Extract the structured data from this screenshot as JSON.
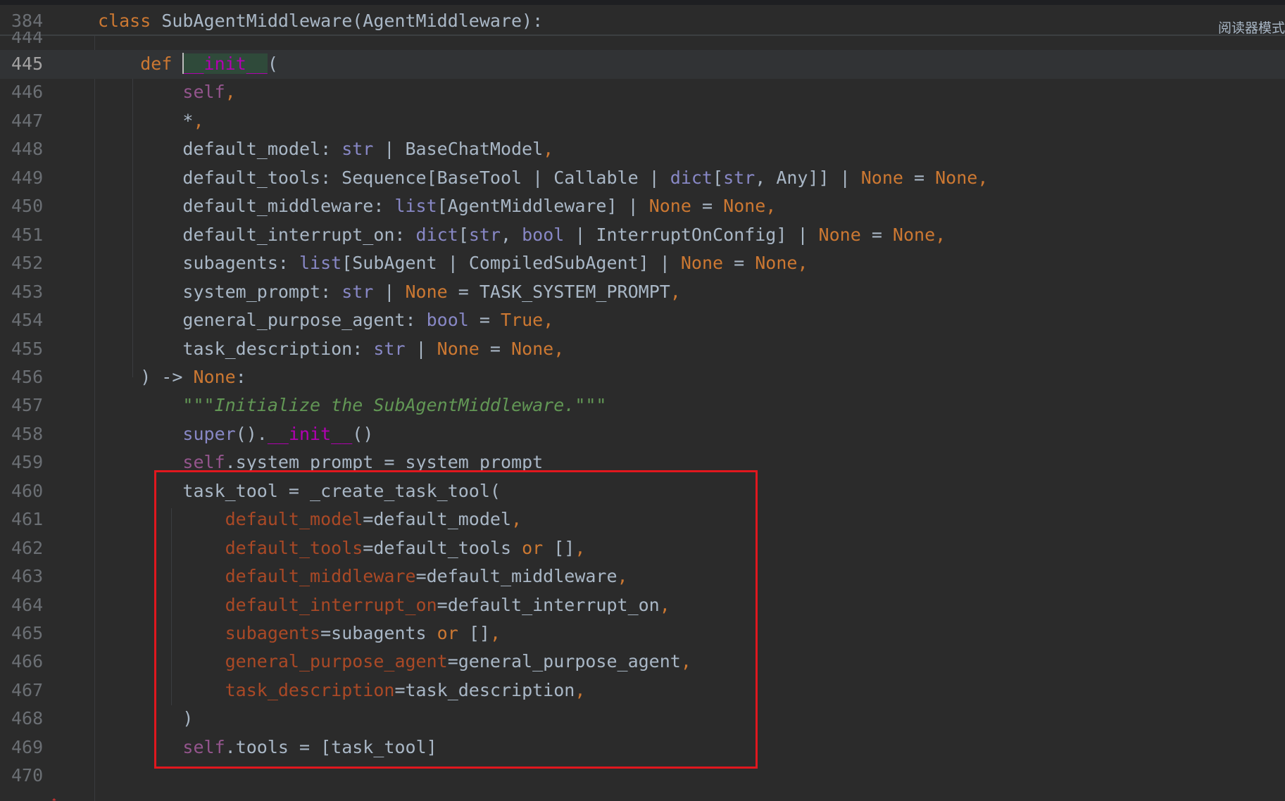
{
  "sticky_header": {
    "line_number": "384",
    "code": "class SubAgentMiddleware(AgentMiddleware):",
    "class_keyword": "class",
    "class_rest": " SubAgentMiddleware(AgentMiddleware):",
    "peek_line_number": "444"
  },
  "reader_mode_label": "阅读器模式",
  "line_numbers": [
    "445",
    "446",
    "447",
    "448",
    "449",
    "450",
    "451",
    "452",
    "453",
    "454",
    "455",
    "456",
    "457",
    "458",
    "459",
    "460",
    "461",
    "462",
    "463",
    "464",
    "465",
    "466",
    "467",
    "468",
    "469",
    "470"
  ],
  "lines": [
    [
      {
        "t": "    "
      },
      {
        "t": "def",
        "c": "kw"
      },
      {
        "t": " "
      },
      {
        "caret": true
      },
      {
        "t": "__init__",
        "c": "dun init-hl"
      },
      {
        "t": "("
      }
    ],
    [
      {
        "t": "        "
      },
      {
        "t": "self",
        "c": "slf"
      },
      {
        "t": ",",
        "c": "kw"
      }
    ],
    [
      {
        "t": "        *"
      },
      {
        "t": ",",
        "c": "kw"
      }
    ],
    [
      {
        "t": "        default_model: "
      },
      {
        "t": "str",
        "c": "bi"
      },
      {
        "t": " | BaseChatModel"
      },
      {
        "t": ",",
        "c": "kw"
      }
    ],
    [
      {
        "t": "        default_tools: Sequence[BaseTool | Callable | "
      },
      {
        "t": "dict",
        "c": "bi"
      },
      {
        "t": "["
      },
      {
        "t": "str",
        "c": "bi"
      },
      {
        "t": ", Any]] | "
      },
      {
        "t": "None",
        "c": "kw"
      },
      {
        "t": " = "
      },
      {
        "t": "None",
        "c": "kw"
      },
      {
        "t": ",",
        "c": "kw"
      }
    ],
    [
      {
        "t": "        default_middleware: "
      },
      {
        "t": "list",
        "c": "bi"
      },
      {
        "t": "[AgentMiddleware] | "
      },
      {
        "t": "None",
        "c": "kw"
      },
      {
        "t": " = "
      },
      {
        "t": "None",
        "c": "kw"
      },
      {
        "t": ",",
        "c": "kw"
      }
    ],
    [
      {
        "t": "        default_interrupt_on: "
      },
      {
        "t": "dict",
        "c": "bi"
      },
      {
        "t": "["
      },
      {
        "t": "str",
        "c": "bi"
      },
      {
        "t": ", "
      },
      {
        "t": "bool",
        "c": "bi"
      },
      {
        "t": " | InterruptOnConfig] | "
      },
      {
        "t": "None",
        "c": "kw"
      },
      {
        "t": " = "
      },
      {
        "t": "None",
        "c": "kw"
      },
      {
        "t": ",",
        "c": "kw"
      }
    ],
    [
      {
        "t": "        subagents: "
      },
      {
        "t": "list",
        "c": "bi"
      },
      {
        "t": "[SubAgent | CompiledSubAgent] | "
      },
      {
        "t": "None",
        "c": "kw"
      },
      {
        "t": " = "
      },
      {
        "t": "None",
        "c": "kw"
      },
      {
        "t": ",",
        "c": "kw"
      }
    ],
    [
      {
        "t": "        system_prompt: "
      },
      {
        "t": "str",
        "c": "bi"
      },
      {
        "t": " | "
      },
      {
        "t": "None",
        "c": "kw"
      },
      {
        "t": " = TASK_SYSTEM_PROMPT"
      },
      {
        "t": ",",
        "c": "kw"
      }
    ],
    [
      {
        "t": "        general_purpose_agent: "
      },
      {
        "t": "bool",
        "c": "bi"
      },
      {
        "t": " = "
      },
      {
        "t": "True",
        "c": "kw"
      },
      {
        "t": ",",
        "c": "kw"
      }
    ],
    [
      {
        "t": "        task_description: "
      },
      {
        "t": "str",
        "c": "bi"
      },
      {
        "t": " | "
      },
      {
        "t": "None",
        "c": "kw"
      },
      {
        "t": " = "
      },
      {
        "t": "None",
        "c": "kw"
      },
      {
        "t": ",",
        "c": "kw"
      }
    ],
    [
      {
        "t": "    ) -> "
      },
      {
        "t": "None",
        "c": "kw"
      },
      {
        "t": ":"
      }
    ],
    [
      {
        "t": "        "
      },
      {
        "t": "\"\"\"Initialize the SubAgentMiddleware.\"\"\"",
        "c": "str"
      }
    ],
    [
      {
        "t": "        "
      },
      {
        "t": "super",
        "c": "bi"
      },
      {
        "t": "()."
      },
      {
        "t": "__init__",
        "c": "dun"
      },
      {
        "t": "()"
      }
    ],
    [
      {
        "t": "        "
      },
      {
        "t": "self",
        "c": "slf"
      },
      {
        "t": ".system_prompt = system_prompt"
      }
    ],
    [
      {
        "t": "        task_tool = _create_task_tool("
      }
    ],
    [
      {
        "t": "            "
      },
      {
        "t": "default_model",
        "c": "prm"
      },
      {
        "t": "=default_model"
      },
      {
        "t": ",",
        "c": "kw"
      }
    ],
    [
      {
        "t": "            "
      },
      {
        "t": "default_tools",
        "c": "prm"
      },
      {
        "t": "=default_tools "
      },
      {
        "t": "or",
        "c": "kw"
      },
      {
        "t": " []"
      },
      {
        "t": ",",
        "c": "kw"
      }
    ],
    [
      {
        "t": "            "
      },
      {
        "t": "default_middleware",
        "c": "prm"
      },
      {
        "t": "=default_middleware"
      },
      {
        "t": ",",
        "c": "kw"
      }
    ],
    [
      {
        "t": "            "
      },
      {
        "t": "default_interrupt_on",
        "c": "prm"
      },
      {
        "t": "=default_interrupt_on"
      },
      {
        "t": ",",
        "c": "kw"
      }
    ],
    [
      {
        "t": "            "
      },
      {
        "t": "subagents",
        "c": "prm"
      },
      {
        "t": "=subagents "
      },
      {
        "t": "or",
        "c": "kw"
      },
      {
        "t": " []"
      },
      {
        "t": ",",
        "c": "kw"
      }
    ],
    [
      {
        "t": "            "
      },
      {
        "t": "general_purpose_agent",
        "c": "prm"
      },
      {
        "t": "=general_purpose_agent"
      },
      {
        "t": ",",
        "c": "kw"
      }
    ],
    [
      {
        "t": "            "
      },
      {
        "t": "task_description",
        "c": "prm"
      },
      {
        "t": "=task_description"
      },
      {
        "t": ",",
        "c": "kw"
      }
    ],
    [
      {
        "t": "        )"
      }
    ],
    [
      {
        "t": "        "
      },
      {
        "t": "self",
        "c": "slf"
      },
      {
        "t": ".tools = [task_tool]"
      }
    ],
    [
      {
        "t": ""
      }
    ]
  ],
  "current_line_index": 0,
  "colors": {
    "background": "#2b2b2b",
    "keyword": "#cc7832",
    "self": "#94558d",
    "builtin": "#8888c6",
    "dunder": "#b200b2",
    "docstring": "#629755",
    "named_argument": "#aa4926",
    "annotation_box": "#e0171e"
  }
}
